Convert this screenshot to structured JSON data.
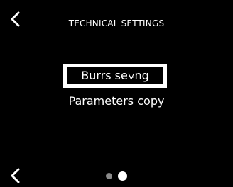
{
  "screen": {
    "title": "TECHNICAL SETTINGS",
    "back_icon": "chevron-left-icon",
    "bottom_back_icon": "chevron-left-icon"
  },
  "menu": {
    "items": [
      {
        "label": "Burrs se⍱ng",
        "selected": true
      },
      {
        "label": "Parameters copy",
        "selected": false
      }
    ]
  },
  "pager": {
    "pages": 2,
    "current_page": 2
  },
  "colors": {
    "background": "#000000",
    "foreground": "#ffffff",
    "inactive_dot": "#8a8a8a"
  }
}
